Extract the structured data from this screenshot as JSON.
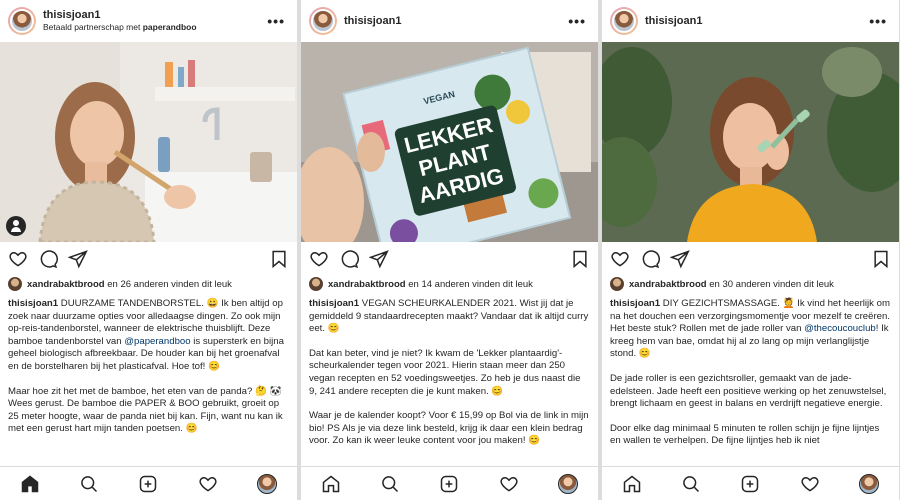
{
  "posts": [
    {
      "username": "thisisjoan1",
      "subtitle_prefix": "Betaald partnerschap met",
      "subtitle_partner": "paperandboo",
      "liker": "xandrabaktbrood",
      "likes_suffix": "en 26 anderen vinden dit leuk",
      "caption_lead": "DUURZAME TANDENBORSTEL. 😀 Ik ben altijd op zoek naar duurzame opties voor alledaagse dingen. Zo ook mijn op-reis-tandenborstel, wanneer de elektrische thuisblijft. Deze bamboe tandenborstel van",
      "caption_mention": "@paperandboo",
      "caption_tail": "is supersterk en bijna geheel biologisch afbreekbaar. De houder kan bij het groenafval en de borstelharen bij het plasticafval. Hoe tof! 😊",
      "caption_p2": "Maar hoe zit het met de bamboe, het eten van de panda? 🤔 🐼 Wees gerust. De bamboe die PAPER & BOO gebruikt, groeit op 25 meter hoogte, waar de panda niet bij kan. Fijn, want nu kan ik met een gerust hart mijn tanden poetsen. 😊"
    },
    {
      "username": "thisisjoan1",
      "book_vegan": "VEGAN",
      "book_title_1": "LEKKER",
      "book_title_2": "PLANT",
      "book_title_3": "AARDIG",
      "liker": "xandrabaktbrood",
      "likes_suffix": "en 14 anderen vinden dit leuk",
      "caption_lead": "VEGAN SCHEURKALENDER 2021. Wist jij dat je gemiddeld 9 standaardrecepten maakt? Vandaar dat ik altijd curry eet. 😊",
      "caption_p2": "Dat kan beter, vind je niet? Ik kwam de 'Lekker plantaardig'-scheurkalender tegen voor 2021. Hierin staan meer dan 250 vegan recepten en 52 voedingsweetjes. Zo heb je dus naast die 9, 241 andere recepten die je kunt maken. 😊",
      "caption_p3": "Waar je de kalender koopt? Voor € 15,99 op Bol via de link in mijn bio! PS Als je via deze link besteld, krijg ik daar een klein bedrag voor. Zo kan ik weer leuke content voor jou maken! 😊"
    },
    {
      "username": "thisisjoan1",
      "liker": "xandrabaktbrood",
      "likes_suffix": "en 30 anderen vinden dit leuk",
      "caption_lead": "DIY GEZICHTSMASSAGE. 💆 Ik vind het heerlijk om na het douchen een verzorgingsmomentje voor mezelf te creëren. Het beste stuk? Rollen met de jade roller van",
      "caption_mention": "@thecoucouclub",
      "caption_tail": "! Ik kreeg hem van bae, omdat hij al zo lang op mijn verlanglijstje stond. 😊",
      "caption_p2": "De jade roller is een gezichtsroller, gemaakt van de jade-edelsteen. Jade heeft een positieve werking op het zenuwstelsel, brengt lichaam en geest in balans en verdrijft negatieve energie.",
      "caption_p3": "Door elke dag minimaal 5 minuten te rollen schijn je fijne lijntjes en wallen te verhelpen. De fijne lijntjes heb ik niet"
    }
  ],
  "icons": {
    "more": "•••",
    "like": "heart-icon",
    "comment": "comment-icon",
    "share": "share-icon",
    "save": "bookmark-icon",
    "home": "home-icon",
    "search": "search-icon",
    "new_post": "plus-square-icon",
    "activity": "heart-icon",
    "profile": "avatar"
  },
  "colors": {
    "text": "#262626",
    "link": "#00376b",
    "border": "#dbdbdb"
  }
}
